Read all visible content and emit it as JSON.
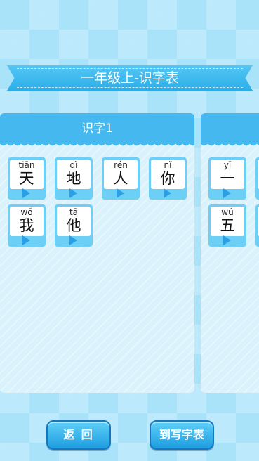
{
  "title": "一年级上-识字表",
  "panels": [
    {
      "header": "识字1",
      "cards": [
        {
          "pinyin": "tiān",
          "char": "天"
        },
        {
          "pinyin": "dì",
          "char": "地"
        },
        {
          "pinyin": "rén",
          "char": "人"
        },
        {
          "pinyin": "nǐ",
          "char": "你"
        },
        {
          "pinyin": "wǒ",
          "char": "我"
        },
        {
          "pinyin": "tā",
          "char": "他"
        }
      ]
    },
    {
      "header": "",
      "cards": [
        {
          "pinyin": "yī",
          "char": "一"
        },
        {
          "pinyin": "wǔ",
          "char": "五"
        }
      ]
    }
  ],
  "buttons": {
    "back": "返 回",
    "table": "到写字表"
  },
  "colors": {
    "accent": "#45b9ef",
    "play": "#2a9fe6"
  }
}
